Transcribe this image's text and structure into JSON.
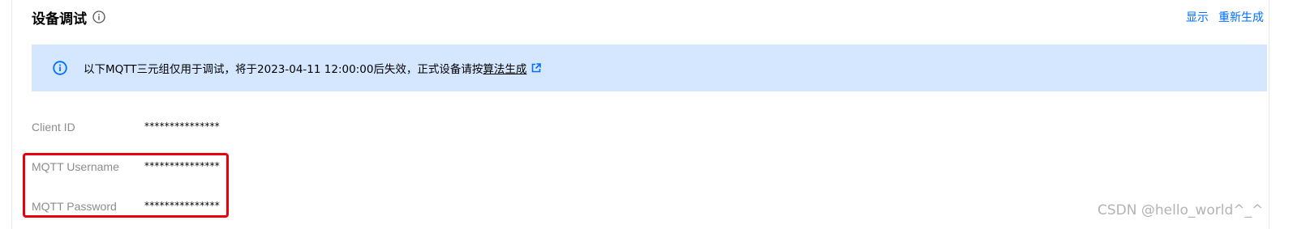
{
  "header": {
    "title": "设备调试",
    "actions": [
      "显示",
      "重新生成"
    ]
  },
  "notice": {
    "text": "以下MQTT三元组仅用于调试，将于2023-04-11 12:00:00后失效，正式设备请按",
    "link": "算法生成"
  },
  "fields": [
    {
      "label": "Client ID",
      "value": "***************"
    },
    {
      "label": "MQTT Username",
      "value": "***************"
    },
    {
      "label": "MQTT Password",
      "value": "***************"
    }
  ],
  "watermark": "CSDN @hello_world^_^",
  "colors": {
    "accent": "#006eff",
    "notice_bg": "#d5e7ff",
    "highlight": "#e8000b"
  }
}
